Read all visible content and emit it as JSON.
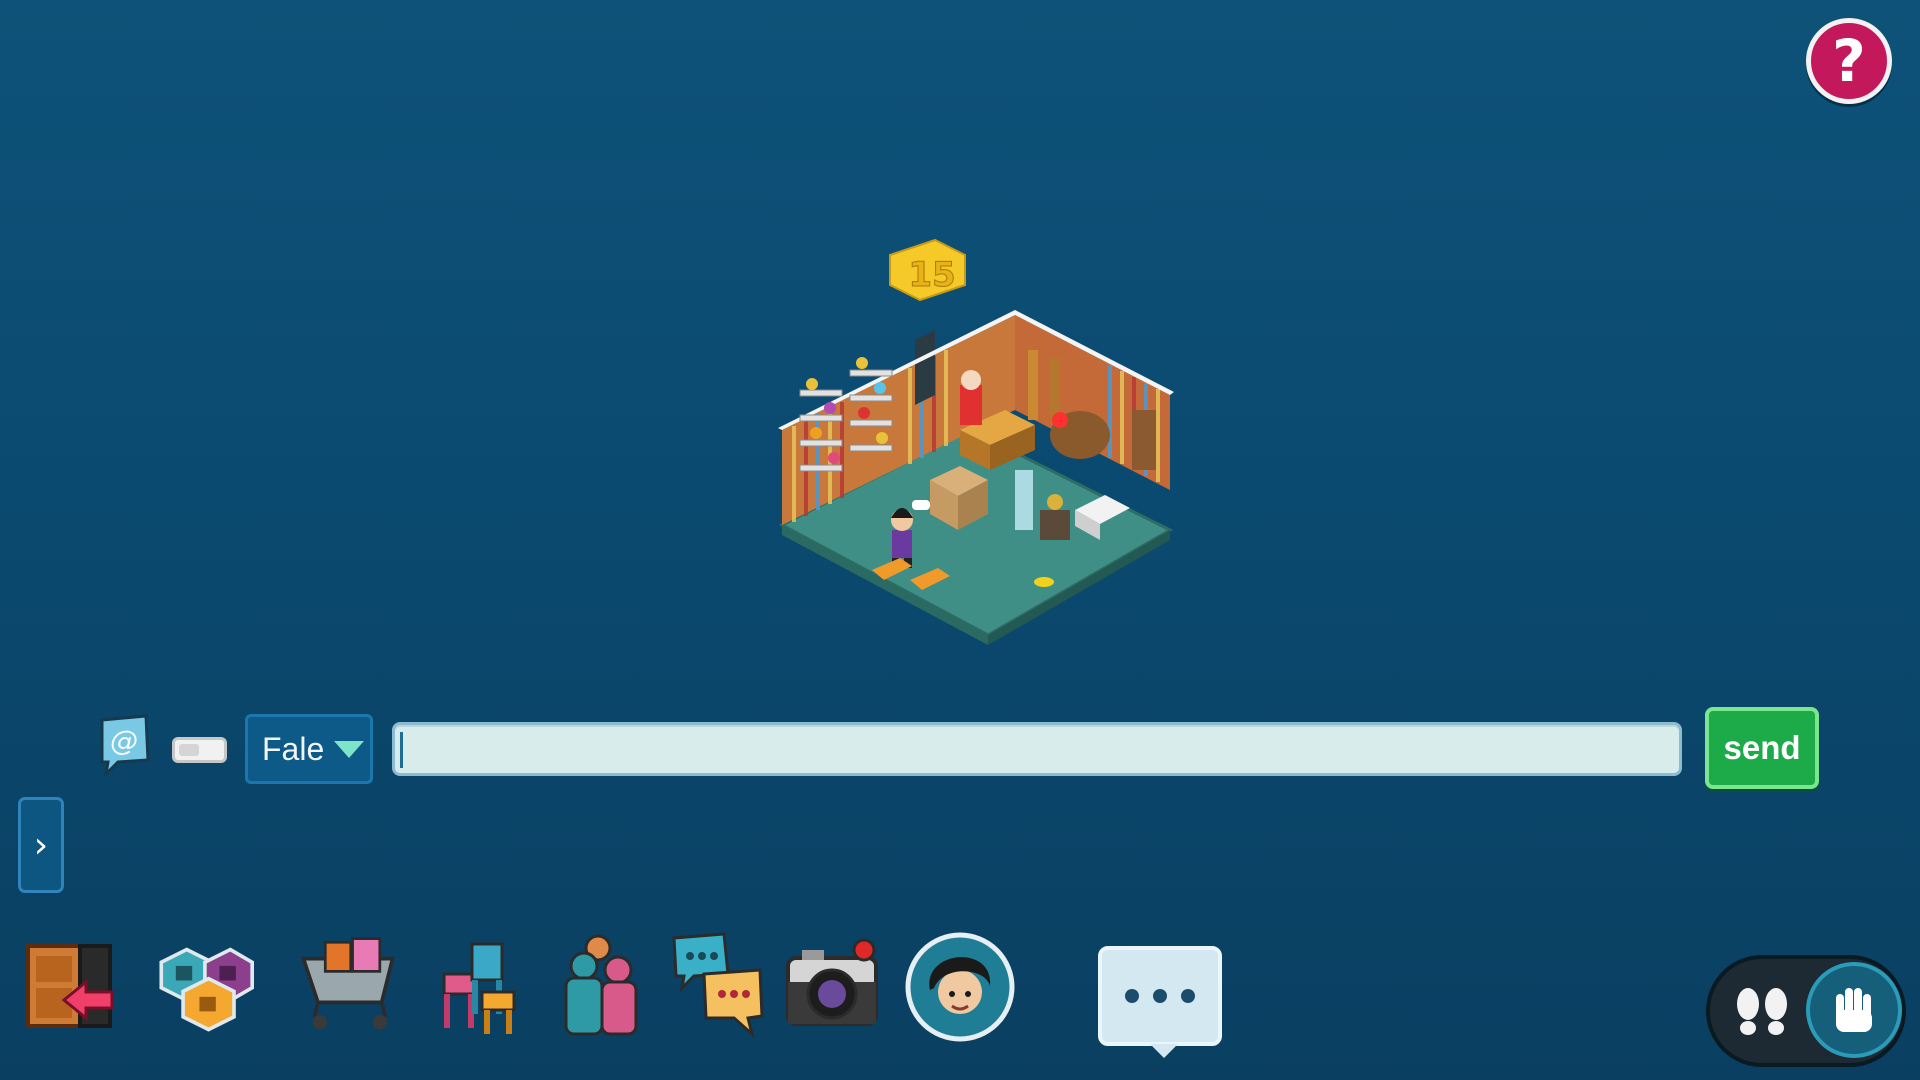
{
  "help": {
    "label": "?"
  },
  "room": {
    "badge_text": "15"
  },
  "chat": {
    "mode_selected": "Fale",
    "input_value": "",
    "send_label": "send"
  },
  "sidebar": {
    "toggle_glyph": "›"
  },
  "toolbar": {
    "items": [
      {
        "icon": "exit-room-icon"
      },
      {
        "icon": "navigator-icon"
      },
      {
        "icon": "catalog-icon"
      },
      {
        "icon": "inventory-icon"
      },
      {
        "icon": "friends-icon"
      },
      {
        "icon": "messenger-icon"
      },
      {
        "icon": "camera-icon"
      },
      {
        "icon": "avatar-icon"
      }
    ],
    "chat_bubble_icon": "chat-bubble-icon"
  },
  "mode_switch": {
    "walk_icon": "footsteps-icon",
    "hand_icon": "hand-icon"
  },
  "colors": {
    "background": "#0b4a70",
    "send": "#1dab4a",
    "help": "#c3185c",
    "caret": "#7de3c9"
  }
}
